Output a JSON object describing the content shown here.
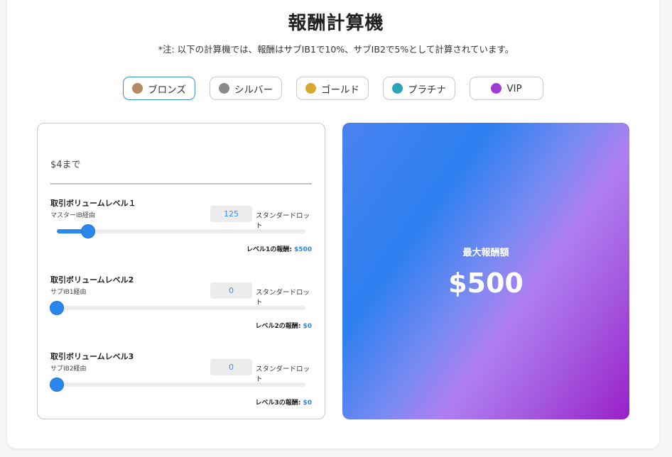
{
  "page": {
    "title": "報酬計算機",
    "note": "*注: 以下の計算機では、報酬はサブIB1で10%、サブIB2で5%として計算されています。"
  },
  "tiers": [
    {
      "label": "ブロンズ",
      "icon": "bronze-medal-icon",
      "color": "#b58a62",
      "active": true
    },
    {
      "label": "シルバー",
      "icon": "silver-medal-icon",
      "color": "#8a8a8a",
      "active": false
    },
    {
      "label": "ゴールド",
      "icon": "gold-medal-icon",
      "color": "#d8a92c",
      "active": false
    },
    {
      "label": "プラチナ",
      "icon": "platinum-medal-icon",
      "color": "#2ba3b8",
      "active": false
    },
    {
      "label": "VIP",
      "icon": "vip-medal-icon",
      "color": "#a23ad8",
      "active": false
    }
  ],
  "calculator": {
    "rate_text": "$4まで",
    "unit": "スタンダードロット",
    "levels": [
      {
        "title": "取引ボリュームレベル１",
        "sub": "マスターIB経由",
        "value": "125",
        "slider_fraction": 0.125,
        "reward_label": "レベル1の報酬: ",
        "reward_value": "$500"
      },
      {
        "title": "取引ボリュームレベル2",
        "sub": "サブIB1経由",
        "value": "0",
        "slider_fraction": 0,
        "reward_label": "レベル2の報酬: ",
        "reward_value": "$0"
      },
      {
        "title": "取引ボリュームレベル3",
        "sub": "サブIB2経由",
        "value": "0",
        "slider_fraction": 0,
        "reward_label": "レベル3の報酬: ",
        "reward_value": "$0"
      }
    ]
  },
  "result": {
    "label": "最大報酬額",
    "value": "$500"
  },
  "colors": {
    "accent": "#2a87ee"
  }
}
